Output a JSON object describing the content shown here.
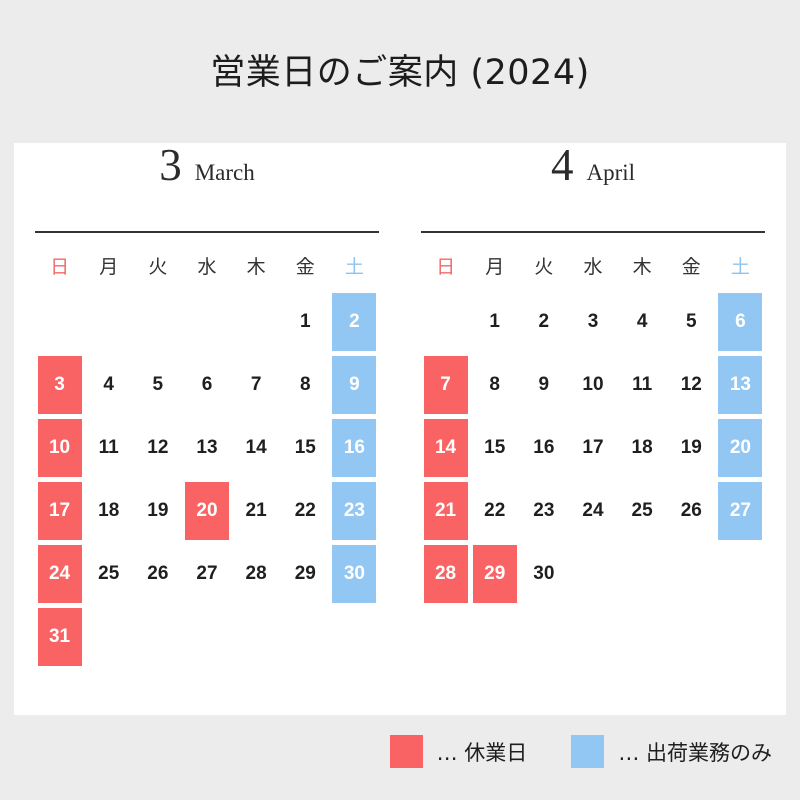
{
  "header": {
    "title": "営業日のご案内 (2024)"
  },
  "colors": {
    "page_background": "#ececec",
    "card_background": "#ffffff",
    "holiday": "#fa6363",
    "shipping_only": "#92c7f3",
    "sunday_label": "#f06a6a",
    "saturday_label": "#8fc3ef",
    "text": "#1f1f1f"
  },
  "weekdays": [
    {
      "label": "日",
      "kind": "sun"
    },
    {
      "label": "月",
      "kind": "weekday"
    },
    {
      "label": "火",
      "kind": "weekday"
    },
    {
      "label": "水",
      "kind": "weekday"
    },
    {
      "label": "木",
      "kind": "weekday"
    },
    {
      "label": "金",
      "kind": "weekday"
    },
    {
      "label": "土",
      "kind": "sat"
    }
  ],
  "months": [
    {
      "number": "3",
      "name": "March",
      "weeks": [
        [
          {
            "label": "",
            "status": "empty"
          },
          {
            "label": "",
            "status": "empty"
          },
          {
            "label": "",
            "status": "empty"
          },
          {
            "label": "",
            "status": "empty"
          },
          {
            "label": "",
            "status": "empty"
          },
          {
            "label": "1",
            "status": "open"
          },
          {
            "label": "2",
            "status": "ship"
          }
        ],
        [
          {
            "label": "3",
            "status": "holiday"
          },
          {
            "label": "4",
            "status": "open"
          },
          {
            "label": "5",
            "status": "open"
          },
          {
            "label": "6",
            "status": "open"
          },
          {
            "label": "7",
            "status": "open"
          },
          {
            "label": "8",
            "status": "open"
          },
          {
            "label": "9",
            "status": "ship"
          }
        ],
        [
          {
            "label": "10",
            "status": "holiday"
          },
          {
            "label": "11",
            "status": "open"
          },
          {
            "label": "12",
            "status": "open"
          },
          {
            "label": "13",
            "status": "open"
          },
          {
            "label": "14",
            "status": "open"
          },
          {
            "label": "15",
            "status": "open"
          },
          {
            "label": "16",
            "status": "ship"
          }
        ],
        [
          {
            "label": "17",
            "status": "holiday"
          },
          {
            "label": "18",
            "status": "open"
          },
          {
            "label": "19",
            "status": "open"
          },
          {
            "label": "20",
            "status": "holiday"
          },
          {
            "label": "21",
            "status": "open"
          },
          {
            "label": "22",
            "status": "open"
          },
          {
            "label": "23",
            "status": "ship"
          }
        ],
        [
          {
            "label": "24",
            "status": "holiday"
          },
          {
            "label": "25",
            "status": "open"
          },
          {
            "label": "26",
            "status": "open"
          },
          {
            "label": "27",
            "status": "open"
          },
          {
            "label": "28",
            "status": "open"
          },
          {
            "label": "29",
            "status": "open"
          },
          {
            "label": "30",
            "status": "ship"
          }
        ],
        [
          {
            "label": "31",
            "status": "holiday"
          },
          {
            "label": "",
            "status": "empty"
          },
          {
            "label": "",
            "status": "empty"
          },
          {
            "label": "",
            "status": "empty"
          },
          {
            "label": "",
            "status": "empty"
          },
          {
            "label": "",
            "status": "empty"
          },
          {
            "label": "",
            "status": "empty"
          }
        ]
      ]
    },
    {
      "number": "4",
      "name": "April",
      "weeks": [
        [
          {
            "label": "",
            "status": "empty"
          },
          {
            "label": "1",
            "status": "open"
          },
          {
            "label": "2",
            "status": "open"
          },
          {
            "label": "3",
            "status": "open"
          },
          {
            "label": "4",
            "status": "open"
          },
          {
            "label": "5",
            "status": "open"
          },
          {
            "label": "6",
            "status": "ship"
          }
        ],
        [
          {
            "label": "7",
            "status": "holiday"
          },
          {
            "label": "8",
            "status": "open"
          },
          {
            "label": "9",
            "status": "open"
          },
          {
            "label": "10",
            "status": "open"
          },
          {
            "label": "11",
            "status": "open"
          },
          {
            "label": "12",
            "status": "open"
          },
          {
            "label": "13",
            "status": "ship"
          }
        ],
        [
          {
            "label": "14",
            "status": "holiday"
          },
          {
            "label": "15",
            "status": "open"
          },
          {
            "label": "16",
            "status": "open"
          },
          {
            "label": "17",
            "status": "open"
          },
          {
            "label": "18",
            "status": "open"
          },
          {
            "label": "19",
            "status": "open"
          },
          {
            "label": "20",
            "status": "ship"
          }
        ],
        [
          {
            "label": "21",
            "status": "holiday"
          },
          {
            "label": "22",
            "status": "open"
          },
          {
            "label": "23",
            "status": "open"
          },
          {
            "label": "24",
            "status": "open"
          },
          {
            "label": "25",
            "status": "open"
          },
          {
            "label": "26",
            "status": "open"
          },
          {
            "label": "27",
            "status": "ship"
          }
        ],
        [
          {
            "label": "28",
            "status": "holiday"
          },
          {
            "label": "29",
            "status": "holiday"
          },
          {
            "label": "30",
            "status": "open"
          },
          {
            "label": "",
            "status": "empty"
          },
          {
            "label": "",
            "status": "empty"
          },
          {
            "label": "",
            "status": "empty"
          },
          {
            "label": "",
            "status": "empty"
          }
        ]
      ]
    }
  ],
  "legend": [
    {
      "swatch": "red",
      "separator": "…",
      "label": "休業日"
    },
    {
      "swatch": "blue",
      "separator": "…",
      "label": "出荷業務のみ"
    }
  ]
}
